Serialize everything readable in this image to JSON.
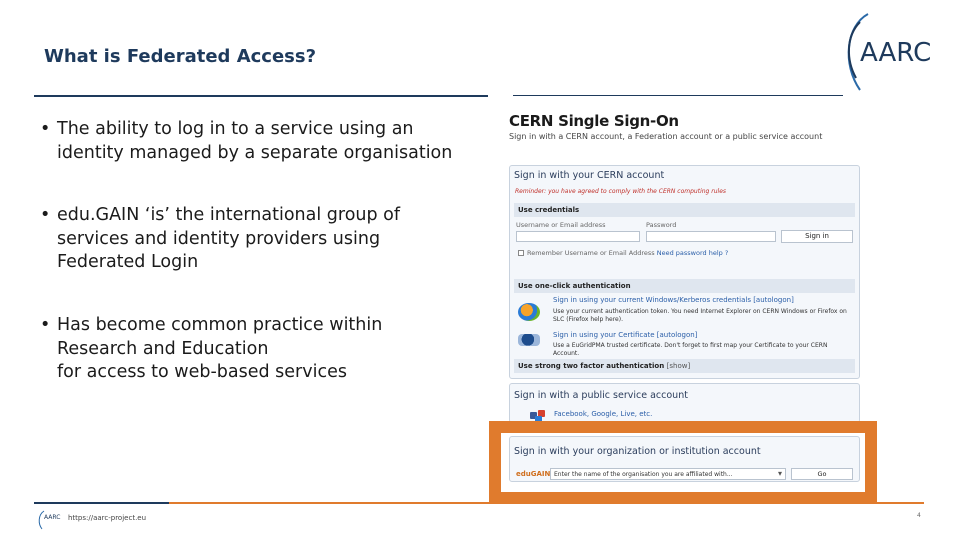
{
  "slide": {
    "title": "What is Federated Access?",
    "logo_text": "AARC",
    "bullets": [
      {
        "lines": [
          "The ability to log in to a service using an",
          "identity managed by a separate organisation"
        ]
      },
      {
        "lines": [
          "edu.GAIN ‘is’ the international group of",
          "services and identity providers using",
          "Federated Login"
        ]
      },
      {
        "lines": [
          "Has become common practice within",
          "Research and Education",
          "for access to web-based services"
        ]
      }
    ],
    "footer_url": "https://aarc-project.eu",
    "footer_logo_text": "AARC",
    "page_number": "4"
  },
  "sso": {
    "title": "CERN Single Sign-On",
    "subtitle": "Sign in with a CERN account, a Federation account or a public service account",
    "cern_box": {
      "heading": "Sign in with your CERN account",
      "reminder": "Reminder: you have agreed to comply with the CERN computing rules",
      "credentials_label": "Use credentials",
      "username_label": "Username or Email address",
      "password_label": "Password",
      "sign_in_button": "Sign in",
      "remember_label": "Remember Username or Email Address",
      "need_help": "Need password help ?",
      "one_click_label": "Use one-click authentication",
      "windows_link": "Sign in using your current Windows/Kerberos credentials [autologon]",
      "windows_desc": "Use your current authentication token. You need Internet Explorer on CERN Windows or Firefox on SLC (Firefox help here).",
      "cert_link": "Sign in using your Certificate [autologon]",
      "cert_desc": "Use a EuGridPMA trusted certificate. Don't forget to first map your Certificate to your CERN Account.",
      "two_factor_label": "Use strong two factor authentication",
      "two_factor_show": "[show]"
    },
    "public_box": {
      "heading": "Sign in with a public service account",
      "providers": "Facebook, Google, Live, etc."
    },
    "org_box": {
      "heading": "Sign in with your organization or institution account",
      "edugain_label": "eduGAIN",
      "select_value": "Enter the name of the organisation you are affiliated with...",
      "go_button": "Go"
    }
  }
}
